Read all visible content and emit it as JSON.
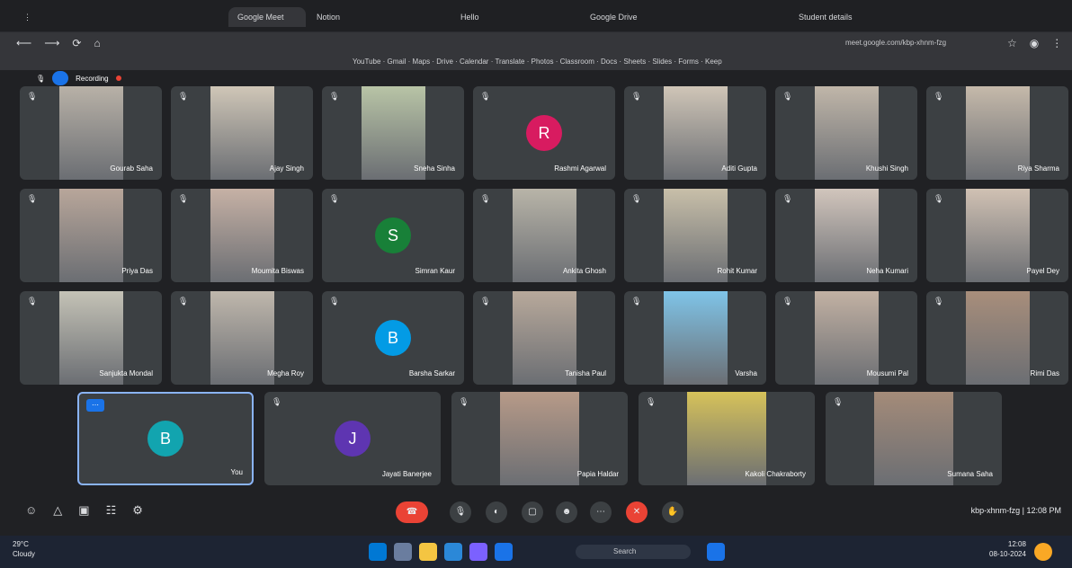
{
  "browser": {
    "tabs": [
      "Google Meet",
      "Notion",
      "Hello",
      "Google Drive",
      "Student details"
    ],
    "address": "meet.google.com/kbp-xhnm-fzg",
    "bookmarks": [
      "YouTube",
      "Gmail",
      "Maps",
      "Drive",
      "Calendar",
      "Translate",
      "Photos",
      "Classroom",
      "Docs",
      "Sheets",
      "Slides",
      "Forms",
      "Keep"
    ]
  },
  "meet": {
    "recording_label": "Recording",
    "participants": [
      {
        "name": "Gourab Saha",
        "avatar": "",
        "color": "#3c4043",
        "video": "#b8b1a7"
      },
      {
        "name": "Ajay Singh",
        "avatar": "",
        "color": "#3c4043",
        "video": "#cfc6b7"
      },
      {
        "name": "Sneha Sinha",
        "avatar": "",
        "color": "#3c4043",
        "video": "#b8c4a6"
      },
      {
        "name": "Rashmi Agarwal",
        "avatar": "R",
        "color": "#d81b60",
        "video": ""
      },
      {
        "name": "Aditi Gupta",
        "avatar": "",
        "color": "#3c4043",
        "video": "#cfc5b7"
      },
      {
        "name": "Khushi Singh",
        "avatar": "",
        "color": "#3c4043",
        "video": "#c0b6a9"
      },
      {
        "name": "Riya Sharma",
        "avatar": "",
        "color": "#3c4043",
        "video": "#c5b9aa"
      },
      {
        "name": "Priya Das",
        "avatar": "",
        "color": "#3c4043",
        "video": "#b8a69a"
      },
      {
        "name": "Moumita Biswas",
        "avatar": "",
        "color": "#3c4043",
        "video": "#c6b1a5"
      },
      {
        "name": "Simran Kaur",
        "avatar": "S",
        "color": "#188038",
        "video": ""
      },
      {
        "name": "Ankita Ghosh",
        "avatar": "",
        "color": "#3c4043",
        "video": "#b8b4a8"
      },
      {
        "name": "Rohit Kumar",
        "avatar": "",
        "color": "#3c4043",
        "video": "#c8bfa9"
      },
      {
        "name": "Neha Kumari",
        "avatar": "",
        "color": "#3c4043",
        "video": "#d1c5bc"
      },
      {
        "name": "Payel Dey",
        "avatar": "",
        "color": "#3c4043",
        "video": "#d0c1b3"
      },
      {
        "name": "Sanjukta Mondal",
        "avatar": "",
        "color": "#3c4043",
        "video": "#c4c2b6"
      },
      {
        "name": "Megha Roy",
        "avatar": "",
        "color": "#3c4043",
        "video": "#bfb7ac"
      },
      {
        "name": "Barsha Sarkar",
        "avatar": "B",
        "color": "#039be5",
        "video": ""
      },
      {
        "name": "Tanisha Paul",
        "avatar": "",
        "color": "#3c4043",
        "video": "#b8a99b"
      },
      {
        "name": "Varsha",
        "avatar": "",
        "color": "#3c4043",
        "video": "#7fc4e8"
      },
      {
        "name": "Mousumi Pal",
        "avatar": "",
        "color": "#3c4043",
        "video": "#c2b1a3"
      },
      {
        "name": "Rimi Das",
        "avatar": "",
        "color": "#3c4043",
        "video": "#a88e7b"
      }
    ],
    "bottom_row": [
      {
        "name": "You",
        "avatar": "B",
        "color": "#12a4af",
        "video": ""
      },
      {
        "name": "Jayati Banerjee",
        "avatar": "J",
        "color": "#5e35b1",
        "video": ""
      },
      {
        "name": "Papia Haldar",
        "avatar": "",
        "color": "#3c4043",
        "video": "#b79a88"
      },
      {
        "name": "Kakoli Chakraborty",
        "avatar": "",
        "color": "#3c4043",
        "video": "#d6c25a"
      },
      {
        "name": "Sumana Saha",
        "avatar": "",
        "color": "#3c4043",
        "video": "#a48b79"
      }
    ],
    "meeting_info": "kbp-xhnm-fzg | 12:08 PM"
  },
  "taskbar": {
    "weather": "29°C\nCloudy",
    "search_placeholder": "Search",
    "time": "12:08\n08-10-2024"
  }
}
